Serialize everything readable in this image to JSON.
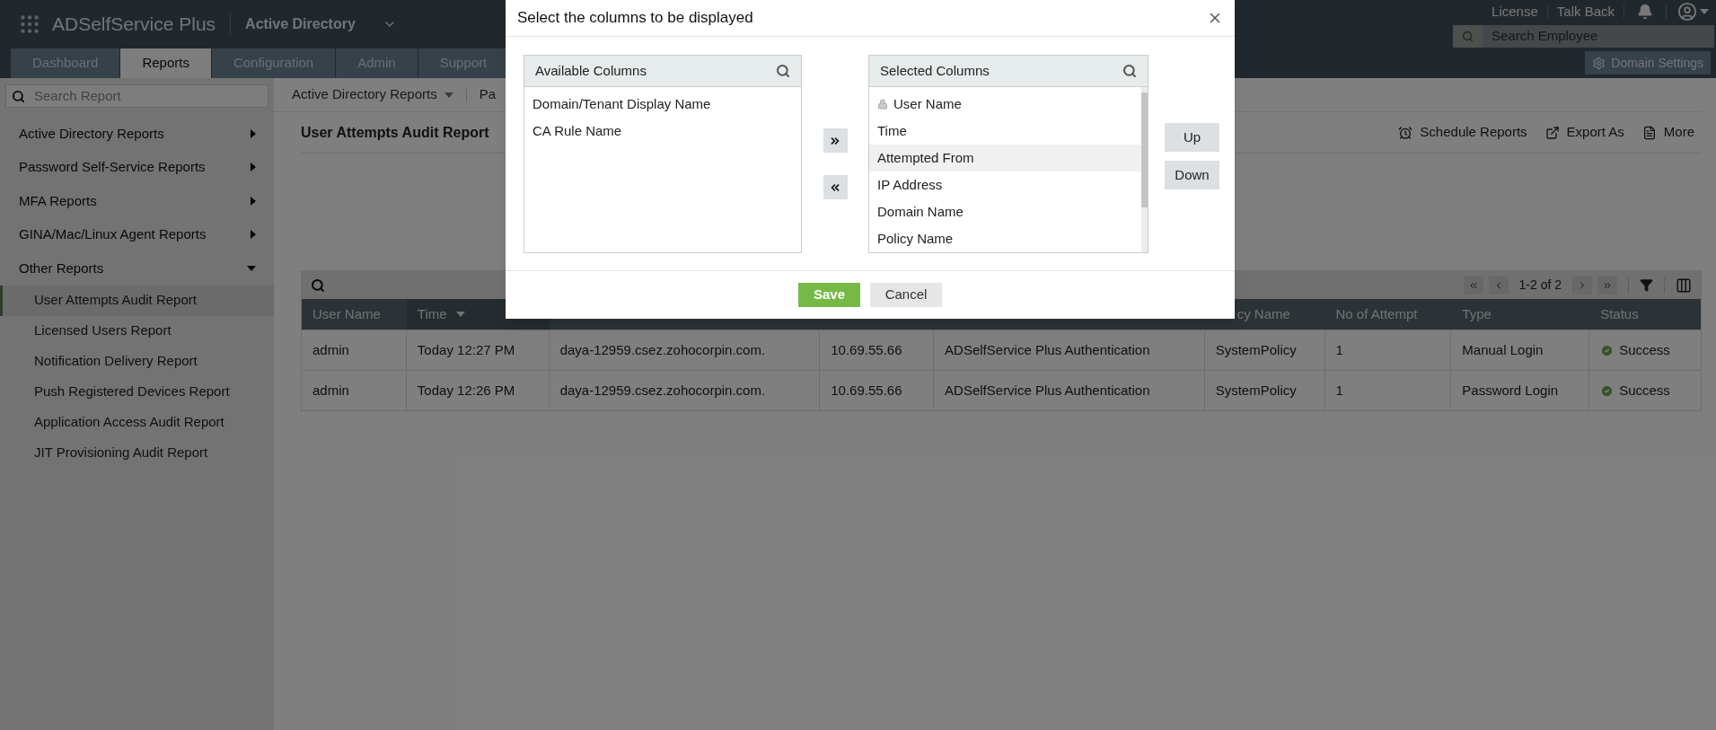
{
  "app": {
    "logo": "ADSelfService Plus",
    "product": "Active Directory"
  },
  "header_links": [
    {
      "label": "License"
    },
    {
      "label": "Talk Back"
    }
  ],
  "nav_tabs": [
    {
      "label": "Dashboard",
      "selected": false
    },
    {
      "label": "Reports",
      "selected": true
    },
    {
      "label": "Configuration",
      "selected": false
    },
    {
      "label": "Admin",
      "selected": false
    },
    {
      "label": "Support",
      "selected": false
    }
  ],
  "employee_search": {
    "placeholder": "Search Employee"
  },
  "domain_settings": "Domain Settings",
  "sidebar": {
    "search_placeholder": "Search Report",
    "categories": [
      {
        "label": "Active Directory Reports",
        "expanded": false
      },
      {
        "label": "Password Self-Service Reports",
        "expanded": false
      },
      {
        "label": "MFA Reports",
        "expanded": false
      },
      {
        "label": "GINA/Mac/Linux Agent Reports",
        "expanded": false
      },
      {
        "label": "Other Reports",
        "expanded": true,
        "children": [
          {
            "label": "User Attempts Audit Report",
            "selected": true
          },
          {
            "label": "Licensed Users Report",
            "selected": false
          },
          {
            "label": "Notification Delivery Report",
            "selected": false
          },
          {
            "label": "Push Registered Devices Report",
            "selected": false
          },
          {
            "label": "Application Access Audit Report",
            "selected": false
          },
          {
            "label": "JIT Provisioning Audit Report",
            "selected": false
          }
        ]
      }
    ]
  },
  "breadcrumb": [
    {
      "label": "Active Directory Reports",
      "dropdown": true
    },
    {
      "label": "Pa",
      "dropdown": false
    }
  ],
  "report": {
    "title": "User Attempts Audit Report",
    "actions": [
      {
        "kind": "schedule",
        "label": "Schedule Reports"
      },
      {
        "kind": "export",
        "label": "Export As"
      },
      {
        "kind": "more",
        "label": "More"
      }
    ]
  },
  "table": {
    "pagination": "1-2 of 2",
    "columns": [
      {
        "kind": "text",
        "label": "User Name",
        "sorted": false
      },
      {
        "kind": "text",
        "label": "Time",
        "sorted": true
      },
      {
        "kind": "covered"
      },
      {
        "kind": "covered"
      },
      {
        "kind": "covered"
      },
      {
        "kind": "text",
        "label": "cy Name",
        "sorted": false
      },
      {
        "kind": "text",
        "label": "No of Attempt",
        "sorted": false
      },
      {
        "kind": "text",
        "label": "Type",
        "sorted": false
      },
      {
        "kind": "text",
        "label": "Status",
        "sorted": false
      }
    ],
    "rows": [
      {
        "cells": [
          "admin",
          "Today 12:27 PM",
          "daya-12959.csez.zohocorpin.com.",
          "10.69.55.66",
          "ADSelfService Plus Authentication",
          "SystemPolicy",
          "1",
          "Manual Login",
          "Success"
        ],
        "kind": "success"
      },
      {
        "cells": [
          "admin",
          "Today 12:26 PM",
          "daya-12959.csez.zohocorpin.com.",
          "10.69.55.66",
          "ADSelfService Plus Authentication",
          "SystemPolicy",
          "1",
          "Password Login",
          "Success"
        ],
        "kind": "success"
      }
    ]
  },
  "dialog": {
    "title": "Select the columns to be displayed",
    "available": {
      "title": "Available Columns",
      "items": [
        {
          "label": "Domain/Tenant Display Name",
          "selected": false
        },
        {
          "label": "CA Rule Name",
          "selected": false
        }
      ]
    },
    "chosen": {
      "title": "Selected Columns",
      "items": [
        {
          "label": "User Name",
          "locked": true,
          "selected": false
        },
        {
          "label": "Time",
          "locked": false,
          "selected": false
        },
        {
          "label": "Attempted From",
          "locked": false,
          "selected": true
        },
        {
          "label": "IP Address",
          "locked": false,
          "selected": false
        },
        {
          "label": "Domain Name",
          "locked": false,
          "selected": false
        },
        {
          "label": "Policy Name",
          "locked": false,
          "selected": false
        }
      ]
    },
    "up": "Up",
    "down": "Down",
    "save": "Save",
    "cancel": "Cancel"
  }
}
